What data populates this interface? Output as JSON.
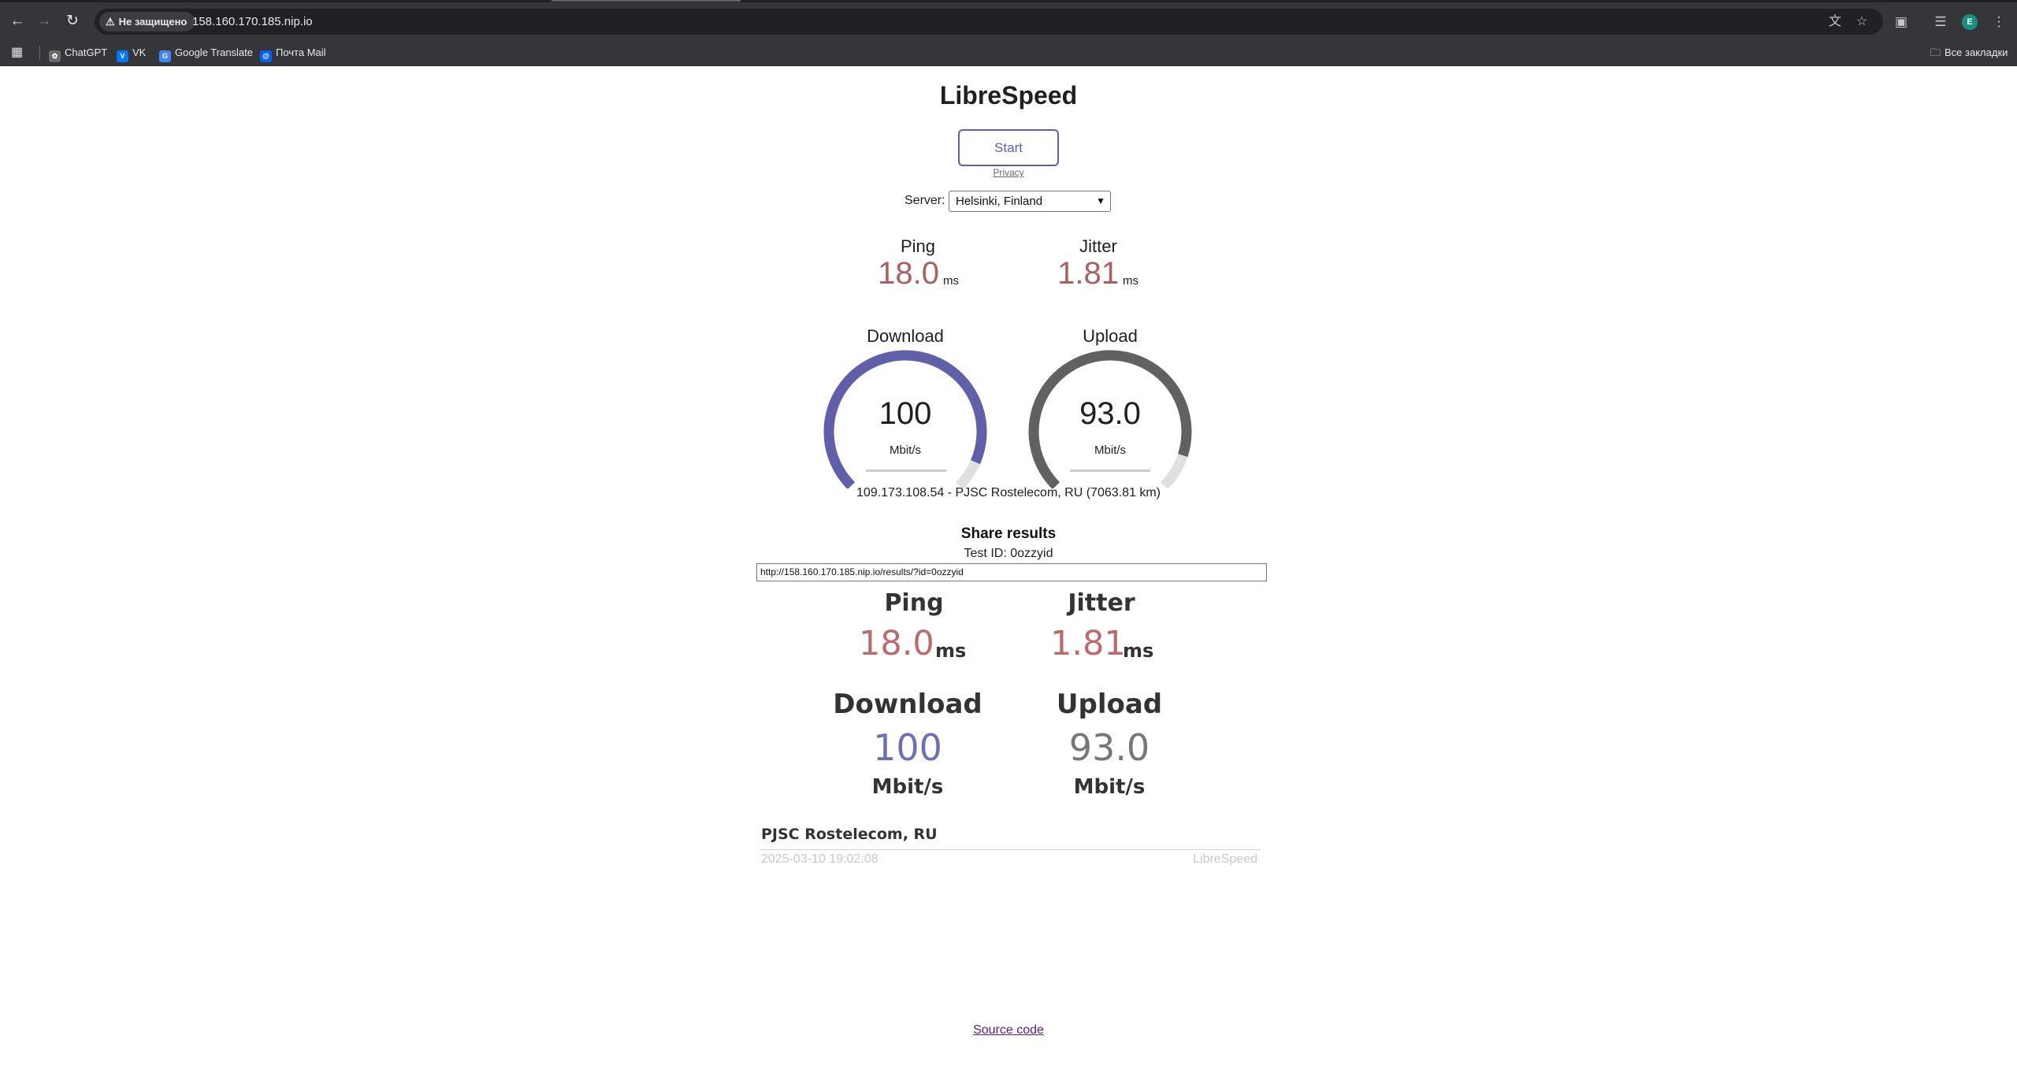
{
  "browser": {
    "security_label": "Не защищено",
    "url": "158.160.170.185.nip.io",
    "avatar_letter": "E",
    "bookmarks": [
      {
        "label": "ChatGPT",
        "icon": "chatgpt-icon"
      },
      {
        "label": "VK",
        "icon": "vk-icon"
      },
      {
        "label": "Google Translate",
        "icon": "google-translate-icon"
      },
      {
        "label": "Почта Mail",
        "icon": "mail-icon"
      }
    ],
    "all_bookmarks_label": "Все закладки"
  },
  "page": {
    "title": "LibreSpeed",
    "start_label": "Start",
    "privacy_label": "Privacy",
    "server_label": "Server:",
    "server_selected": "Helsinki, Finland",
    "ping_label": "Ping",
    "ping_value": "18.0",
    "ping_unit": "ms",
    "jitter_label": "Jitter",
    "jitter_value": "1.81",
    "jitter_unit": "ms",
    "download_label": "Download",
    "download_value": "100",
    "download_unit": "Mbit/s",
    "download_fraction": 0.92,
    "upload_label": "Upload",
    "upload_value": "93.0",
    "upload_unit": "Mbit/s",
    "upload_fraction": 0.9,
    "ip_info": "109.173.108.54 - PJSC Rostelecom, RU (7063.81 km)",
    "share_title": "Share results",
    "test_id": "Test ID: 0ozzyid",
    "share_url": "http://158.160.170.185.nip.io/results/?id=0ozzyid",
    "source_code_label": "Source code"
  },
  "result_card": {
    "ping_label": "Ping",
    "ping_value": "18.0",
    "ping_unit": "ms",
    "jitter_label": "Jitter",
    "jitter_value": "1.81",
    "jitter_unit": "ms",
    "download_label": "Download",
    "download_value": "100",
    "download_unit": "Mbit/s",
    "upload_label": "Upload",
    "upload_value": "93.0",
    "upload_unit": "Mbit/s",
    "isp": "PJSC Rostelecom, RU",
    "timestamp": "2025-03-10 19:02:08",
    "brand": "LibreSpeed"
  },
  "colors": {
    "download_arc": "#6060aa",
    "upload_arc": "#616161",
    "track": "#e0e0e0",
    "value_red": "#aa6060"
  }
}
